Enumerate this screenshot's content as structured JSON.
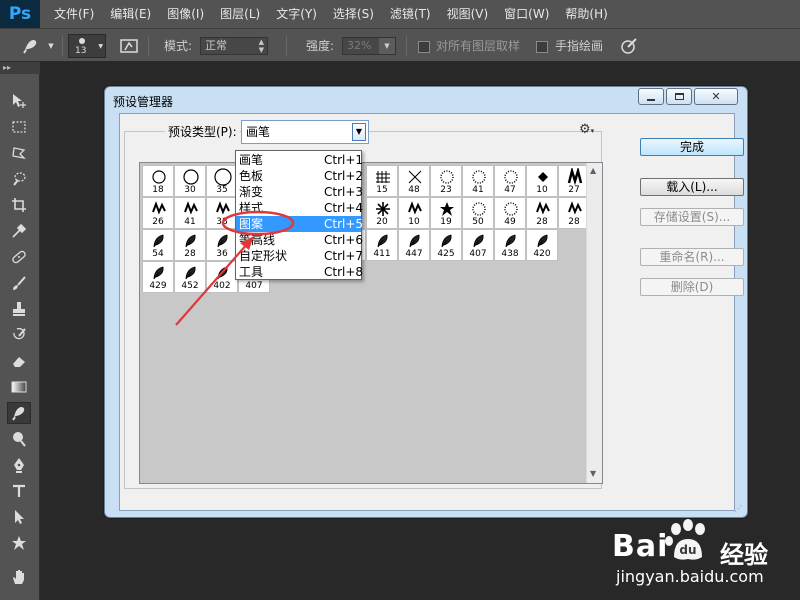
{
  "app": {
    "logo": "Ps"
  },
  "menubar": {
    "items": [
      "文件(F)",
      "编辑(E)",
      "图像(I)",
      "图层(L)",
      "文字(Y)",
      "选择(S)",
      "滤镜(T)",
      "视图(V)",
      "窗口(W)",
      "帮助(H)"
    ]
  },
  "options_bar": {
    "brush_size": "13",
    "mode_label": "模式:",
    "mode_value": "正常",
    "strength_label": "强度:",
    "strength_value": "32%",
    "sample_all_label": "对所有图层取样",
    "finger_paint_label": "手指绘画"
  },
  "dialog": {
    "title": "预设管理器",
    "preset_type_label": "预设类型(P):",
    "preset_type_value": "画笔",
    "buttons": {
      "done": "完成",
      "load": "载入(L)...",
      "save_set": "存储设置(S)...",
      "rename": "重命名(R)...",
      "delete": "删除(D)"
    },
    "brush_sizes": [
      [
        "18",
        "30",
        "35",
        "",
        "",
        "",
        "",
        "15",
        "48",
        "23",
        "41",
        "47",
        "10",
        "27"
      ],
      [
        "26",
        "41",
        "38",
        "",
        "",
        "",
        "",
        "20",
        "10",
        "19",
        "50",
        "49",
        "28",
        "28"
      ],
      [
        "54",
        "28",
        "36",
        "",
        "",
        "",
        "447",
        "411",
        "447",
        "425",
        "407",
        "438",
        "420"
      ],
      [
        "429",
        "452",
        "402",
        "407"
      ]
    ]
  },
  "dropdown": {
    "items": [
      {
        "label": "画笔",
        "shortcut": "Ctrl+1"
      },
      {
        "label": "色板",
        "shortcut": "Ctrl+2"
      },
      {
        "label": "渐变",
        "shortcut": "Ctrl+3"
      },
      {
        "label": "样式",
        "shortcut": "Ctrl+4"
      },
      {
        "label": "图案",
        "shortcut": "Ctrl+5"
      },
      {
        "label": "等高线",
        "shortcut": "Ctrl+6"
      },
      {
        "label": "自定形状",
        "shortcut": "Ctrl+7"
      },
      {
        "label": "工具",
        "shortcut": "Ctrl+8"
      }
    ],
    "selected_index": 4
  },
  "watermark": {
    "brand": "Bai",
    "suffix": "经验",
    "url": "jingyan.baidu.com"
  },
  "colors": {
    "selection": "#3399ff",
    "annotation": "#e0373b",
    "ps_blue": "#31a8ff"
  }
}
